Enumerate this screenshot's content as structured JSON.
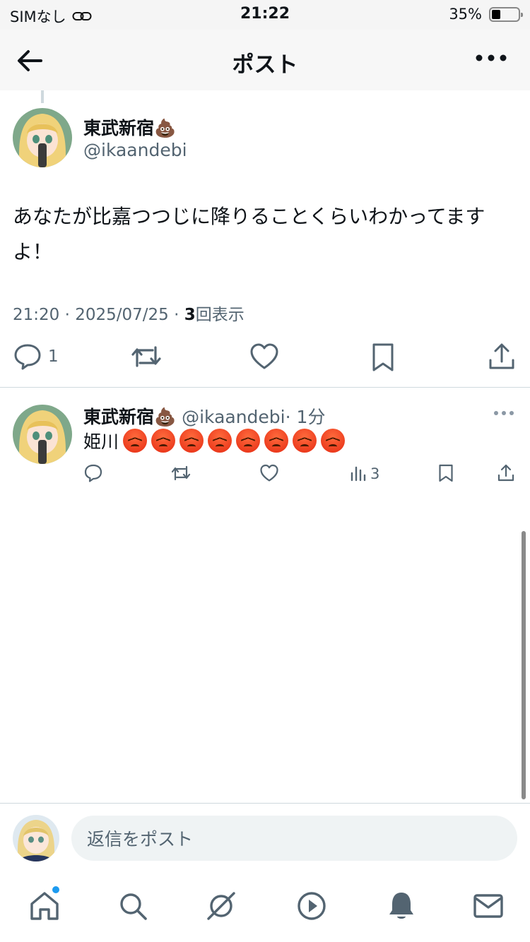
{
  "status_bar": {
    "carrier": "SIMなし",
    "time": "21:22",
    "battery": "35%",
    "battery_level": 0.35
  },
  "header": {
    "title": "ポスト"
  },
  "main_post": {
    "author_name": "東武新宿💩",
    "author_handle": "@ikaandebi",
    "text": "あなたが比嘉つつじに降りることくらいわかってますよ！",
    "timestamp": "21:20 · 2025/07/25 · ",
    "views": "3",
    "views_label": "回表示",
    "reply_count": "1"
  },
  "reply": {
    "author_name": "東武新宿💩",
    "author_handle": "@ikaandebi",
    "time_ago": "· 1分",
    "text": "姫川",
    "emoji_count": 8,
    "emoji_icon": "angry-face-icon",
    "views": "3"
  },
  "compose": {
    "placeholder": "返信をポスト"
  },
  "tabs": [
    "home-icon",
    "search-icon",
    "grok-icon",
    "video-icon",
    "notifications-icon",
    "messages-icon"
  ],
  "colors": {
    "accent": "#1d9bf0",
    "secondary_text": "#536471",
    "primary_text": "#0f1419"
  }
}
